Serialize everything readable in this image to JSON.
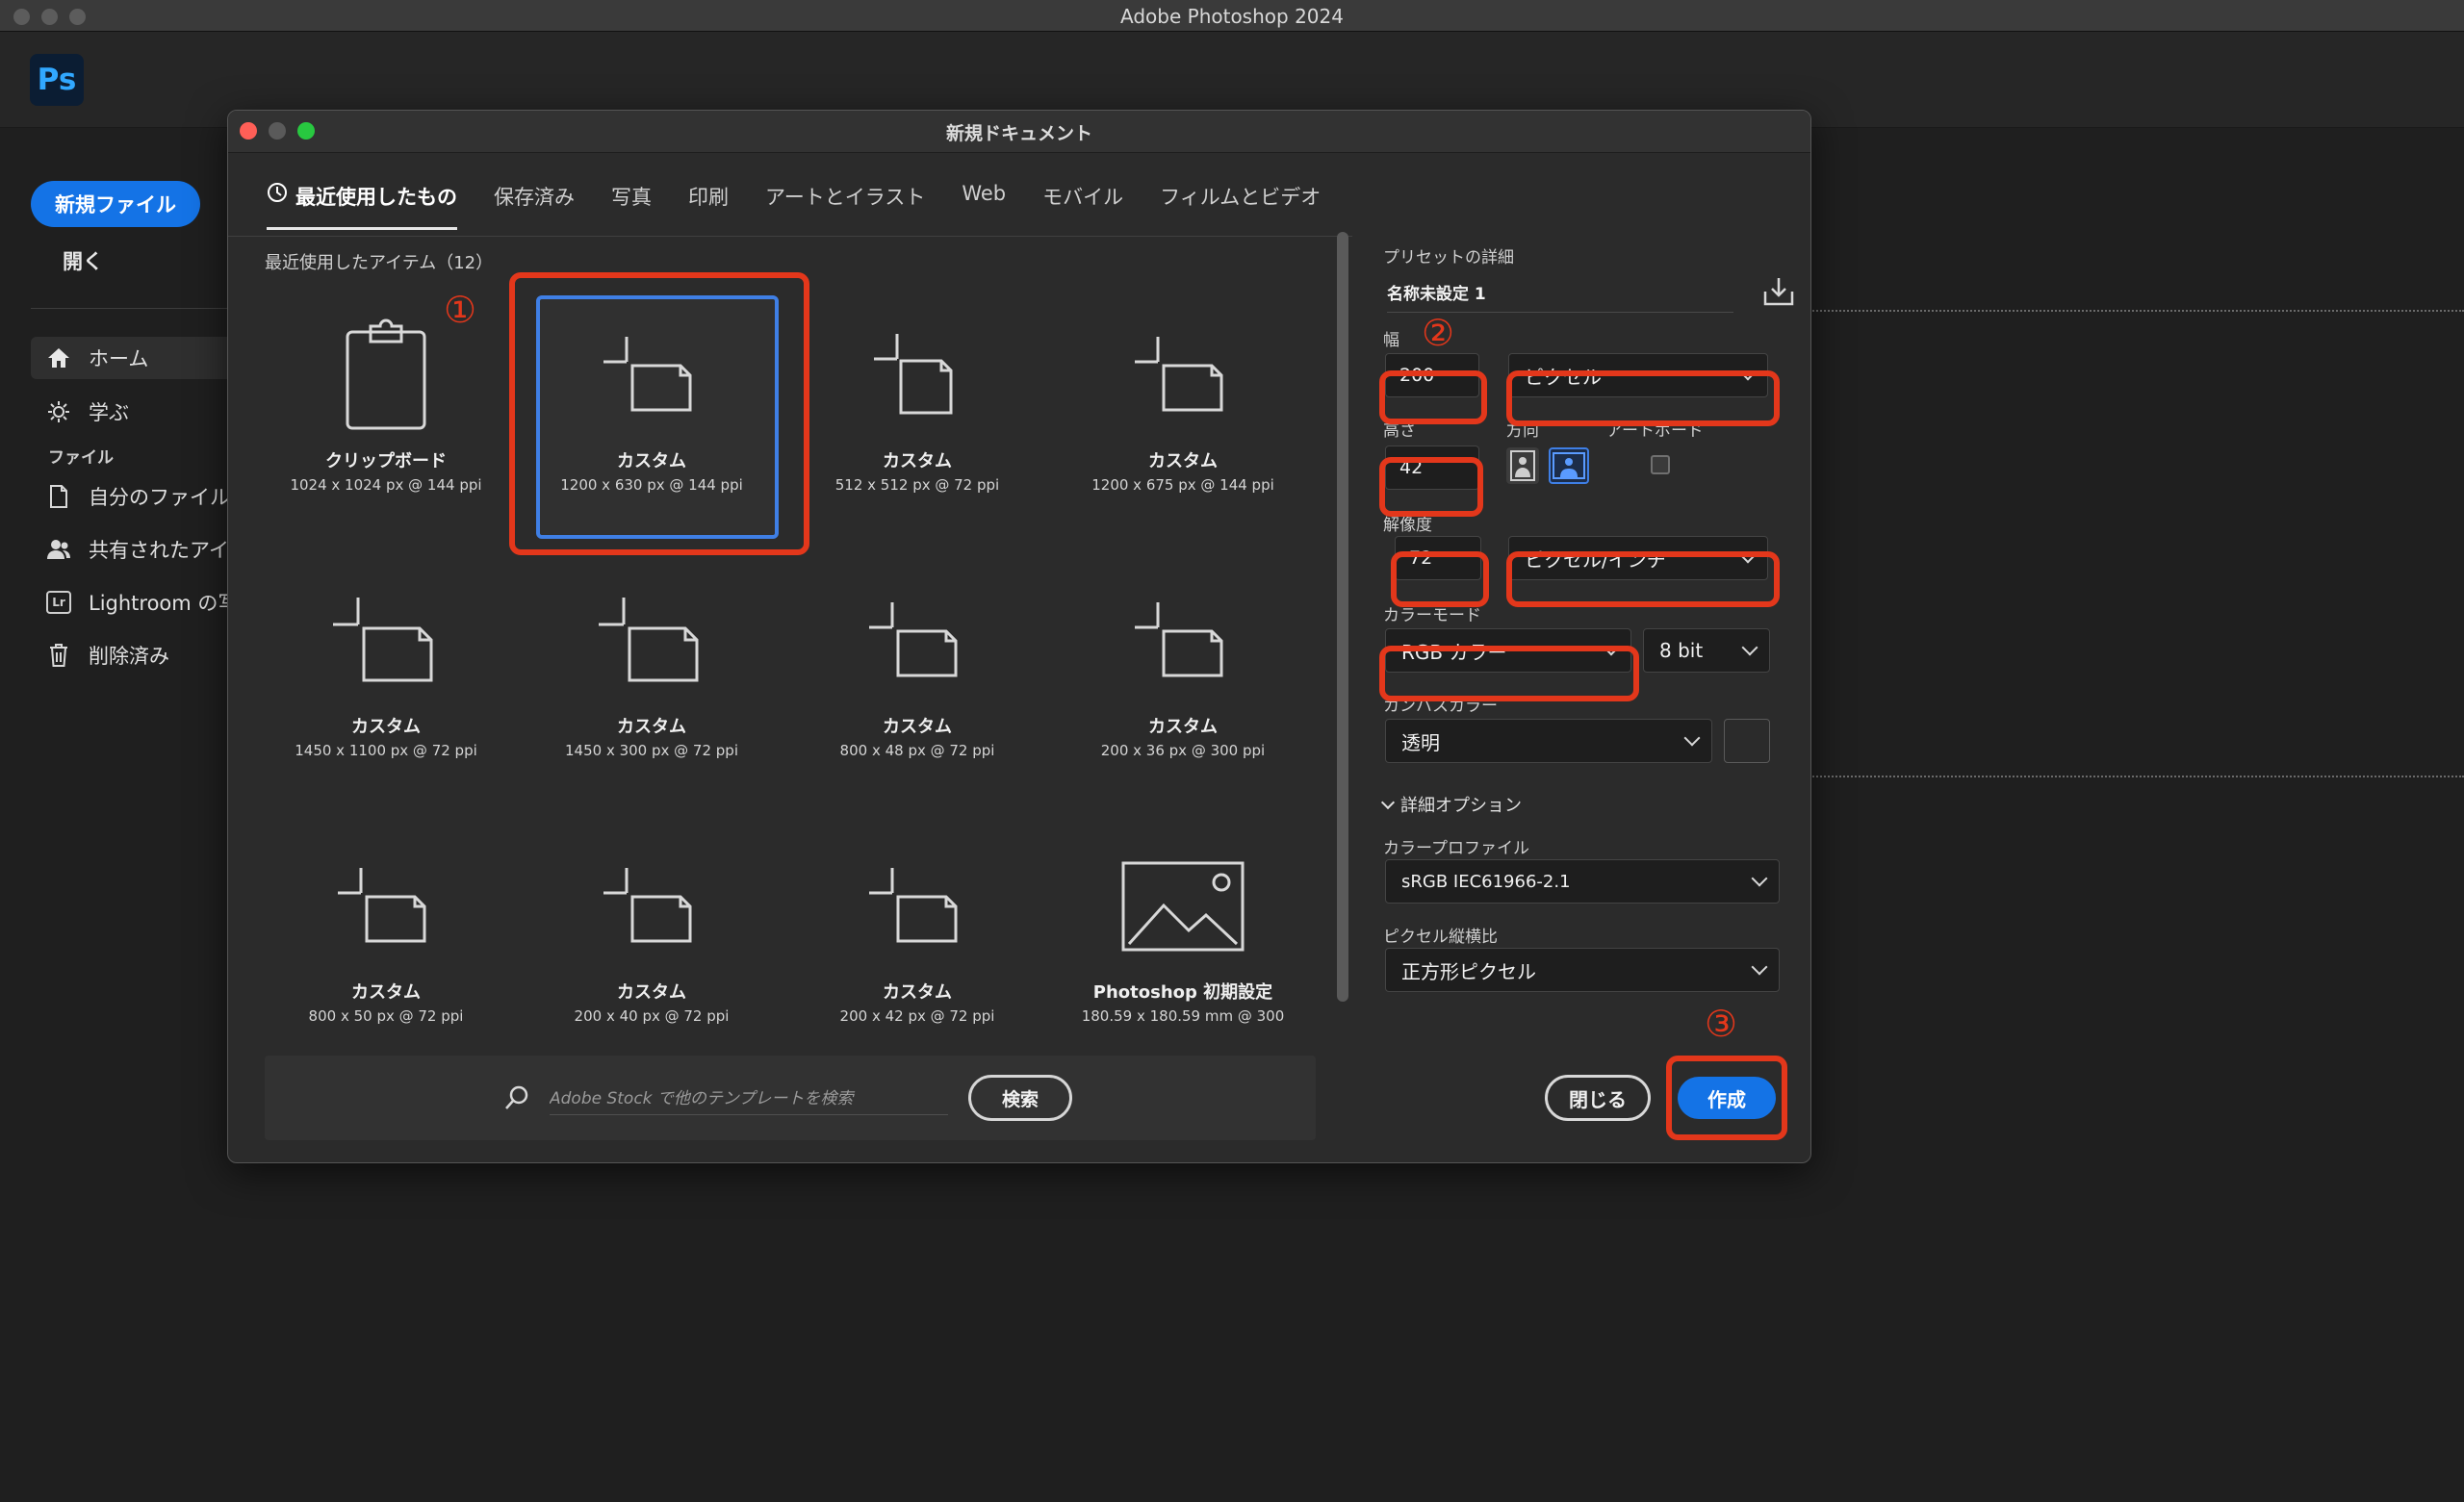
{
  "os": {
    "title": "Adobe Photoshop 2024"
  },
  "app": {
    "logo": "Ps"
  },
  "sidebar": {
    "new_file": "新規ファイル",
    "open": "開く",
    "section_files": "ファイル",
    "items": [
      {
        "label": "ホーム",
        "icon": "home-icon"
      },
      {
        "label": "学ぶ",
        "icon": "lightbulb-icon"
      },
      {
        "label": "自分のファイル",
        "icon": "file-icon"
      },
      {
        "label": "共有されたアイテム",
        "icon": "people-icon"
      },
      {
        "label": "Lightroom の写真",
        "icon": "lightroom-icon",
        "badge": "Lr"
      },
      {
        "label": "削除済み",
        "icon": "trash-icon"
      }
    ]
  },
  "dialog": {
    "title": "新規ドキュメント",
    "tabs": [
      "最近使用したもの",
      "保存済み",
      "写真",
      "印刷",
      "アートとイラスト",
      "Web",
      "モバイル",
      "フィルムとビデオ"
    ],
    "recent_label": "最近使用したアイテム（12）",
    "tiles": [
      {
        "name": "クリップボード",
        "size": "1024 x 1024 px @ 144 ppi"
      },
      {
        "name": "カスタム",
        "size": "1200 x 630 px @ 144 ppi"
      },
      {
        "name": "カスタム",
        "size": "512 x 512 px @ 72 ppi"
      },
      {
        "name": "カスタム",
        "size": "1200 x 675 px @ 144 ppi"
      },
      {
        "name": "カスタム",
        "size": "1450 x 1100 px @ 72 ppi"
      },
      {
        "name": "カスタム",
        "size": "1450 x 300 px @ 72 ppi"
      },
      {
        "name": "カスタム",
        "size": "800 x 48 px @ 72 ppi"
      },
      {
        "name": "カスタム",
        "size": "200 x 36 px @ 300 ppi"
      },
      {
        "name": "カスタム",
        "size": "800 x 50 px @ 72 ppi"
      },
      {
        "name": "カスタム",
        "size": "200 x 40 px @ 72 ppi"
      },
      {
        "name": "カスタム",
        "size": "200 x 42 px @ 72 ppi"
      },
      {
        "name": "Photoshop 初期設定",
        "size": "180.59 x 180.59 mm @ 300"
      }
    ],
    "search": {
      "placeholder": "Adobe Stock で他のテンプレートを検索",
      "button": "検索"
    },
    "annotations": {
      "one": "①",
      "two": "②",
      "three": "③"
    },
    "preset": {
      "heading": "プリセットの詳細",
      "name": "名称未設定 1",
      "width_label": "幅",
      "width_value": "200",
      "width_unit": "ピクセル",
      "height_label": "高さ",
      "height_value": "42",
      "orientation_label": "方向",
      "artboard_label": "アートボード",
      "resolution_label": "解像度",
      "resolution_value": "72",
      "resolution_unit": "ピクセル/インチ",
      "color_mode_label": "カラーモード",
      "color_mode": "RGB カラー",
      "bit_depth": "8 bit",
      "canvas_color_label": "カンバスカラー",
      "canvas_color": "透明",
      "advanced_label": "詳細オプション",
      "color_profile_label": "カラープロファイル",
      "color_profile": "sRGB IEC61966-2.1",
      "pixel_aspect_label": "ピクセル縦横比",
      "pixel_aspect": "正方形ピクセル",
      "close_button": "閉じる",
      "create_button": "作成"
    }
  },
  "colors": {
    "accent": "#1473e6",
    "annotation": "#e3371b",
    "selected_border": "#3f7fe5"
  }
}
